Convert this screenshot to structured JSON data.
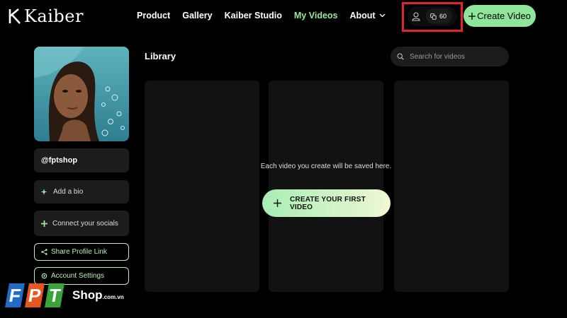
{
  "app": {
    "logo_text": "Kaiber"
  },
  "nav": {
    "items": [
      "Product",
      "Gallery",
      "Kaiber Studio",
      "My Videos",
      "About"
    ],
    "active": "My Videos"
  },
  "account": {
    "credits": "60"
  },
  "header": {
    "create_label": "Create Video"
  },
  "profile": {
    "username": "@fptshop",
    "add_bio": "Add a bio",
    "connect_socials": "Connect your socials",
    "share_link": "Share Profile Link",
    "account_settings": "Account Settings"
  },
  "library": {
    "title": "Library",
    "search_placeholder": "Search for videos",
    "empty_message": "Each video you create will be saved here.",
    "create_first": "CREATE YOUR FIRST VIDEO"
  },
  "watermark": {
    "brand": "FPT",
    "shop": "Shop",
    "domain": ".com.vn"
  },
  "colors": {
    "accent": "#8fe59a",
    "highlight": "#e0252a",
    "background": "#000000"
  }
}
